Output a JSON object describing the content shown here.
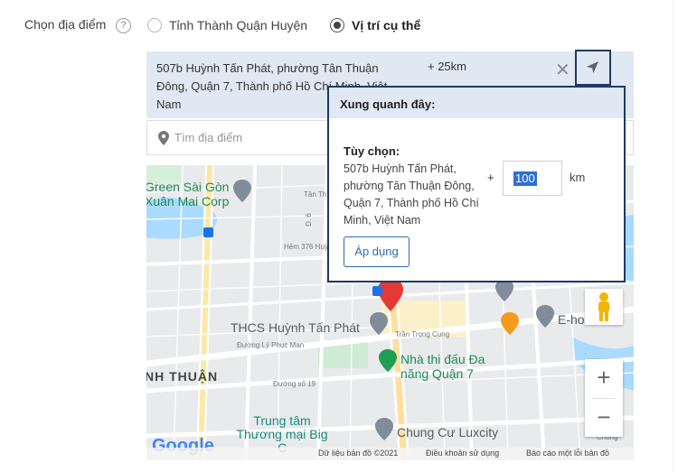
{
  "location_picker": {
    "label": "Chọn địa điểm",
    "help": "?",
    "options": [
      {
        "label": "Tỉnh Thành Quận Huyện",
        "selected": false
      },
      {
        "label": "Vị trí cụ thể",
        "selected": true
      }
    ]
  },
  "address_bar": {
    "address": "507b Huỳnh Tấn Phát, phường Tân Thuận Đông, Quận 7, Thành phố Hồ Chí Minh, Việt Nam",
    "radius": "+ 25km",
    "clear_icon": "close-icon",
    "locate_icon": "navigation-arrow-icon"
  },
  "search": {
    "placeholder": "Tìm địa điểm",
    "value": "",
    "icon": "map-pin-icon"
  },
  "map": {
    "labels": {
      "green_saigon": "Green Sài Gòn",
      "xuan_mai": "Xuân Mai Corp",
      "tan_thuan": "Tân Th",
      "d6": "D. 6",
      "hem376": "Hẻm 376 Huỳ",
      "thcs": "THCS Huỳnh Tấn Phát",
      "ly_phuc_man": "Đường Lý Phục Man",
      "tran_trong_cung": "Trần Trọng Cung",
      "nh_thuan": "NH THUẬN",
      "nha_thi": "Nhà thi đấu Đa năng Quận 7",
      "duong_so19": "Đường số 19",
      "trung_tam": "Trung tâm Thương mại Big C",
      "chung_cu": "Chung Cư Luxcity",
      "eho": "E-ho",
      "chung_right": "Chung",
      "google": "Google"
    },
    "footer": {
      "copyright": "Dữ liệu bản đồ ©2021",
      "terms": "Điều khoản sử dụng",
      "report": "Báo cáo một lỗi bản đồ"
    },
    "zoom_in": "+",
    "zoom_out": "−"
  },
  "popup": {
    "title": "Xung quanh đây:",
    "option_label": "Tùy chọn:",
    "address": "507b Huỳnh Tấn Phát, phường Tân Thuận Đông, Quận 7, Thành phố Hồ Chí Minh, Việt Nam",
    "plus": "+",
    "radius_value": "100",
    "unit": "km",
    "apply": "Áp dụng"
  },
  "colors": {
    "accent_blue": "#2e6bb8",
    "highlight": "#2f6fd1",
    "panel_bg": "#dfe8f3",
    "popup_border": "#1f3a64",
    "marker_red": "#e53935"
  }
}
